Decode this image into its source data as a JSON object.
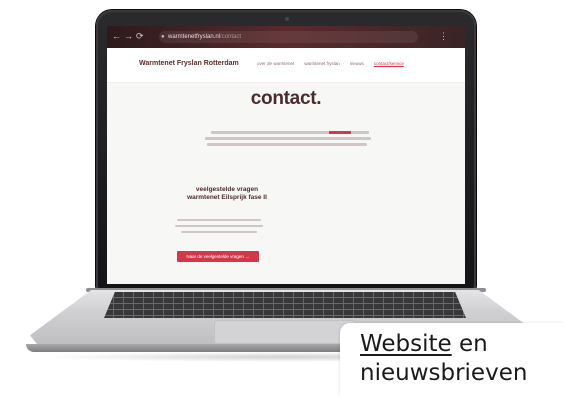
{
  "browser": {
    "nav_back": "←",
    "nav_forward": "→",
    "nav_reload": "⟳",
    "lock_icon": "lock-icon",
    "url": "warmtenetfryslan.nl",
    "url_rest": "/contact",
    "menu_glyph": "⋮"
  },
  "site": {
    "logo": "Warmtenet Fryslan Rotterdam",
    "nav": [
      "over de warmtenet",
      "warmtenet fryslan",
      "nieuws",
      "contact/service"
    ],
    "active_nav_index": 3,
    "title": "contact.",
    "faq_title_line1": "veelgestelde vragen",
    "faq_title_line2": "warmtenet Eilsprijk fase II",
    "faq_button": "Naar de veelgestelde vragen →"
  },
  "caption": {
    "word_underlined": "Website",
    "word_rest": "en",
    "line2": "nieuwsbrieven"
  },
  "colors": {
    "accent": "#d2374a",
    "heading": "#4a2c2c",
    "browser_bar": "#3a2426"
  }
}
